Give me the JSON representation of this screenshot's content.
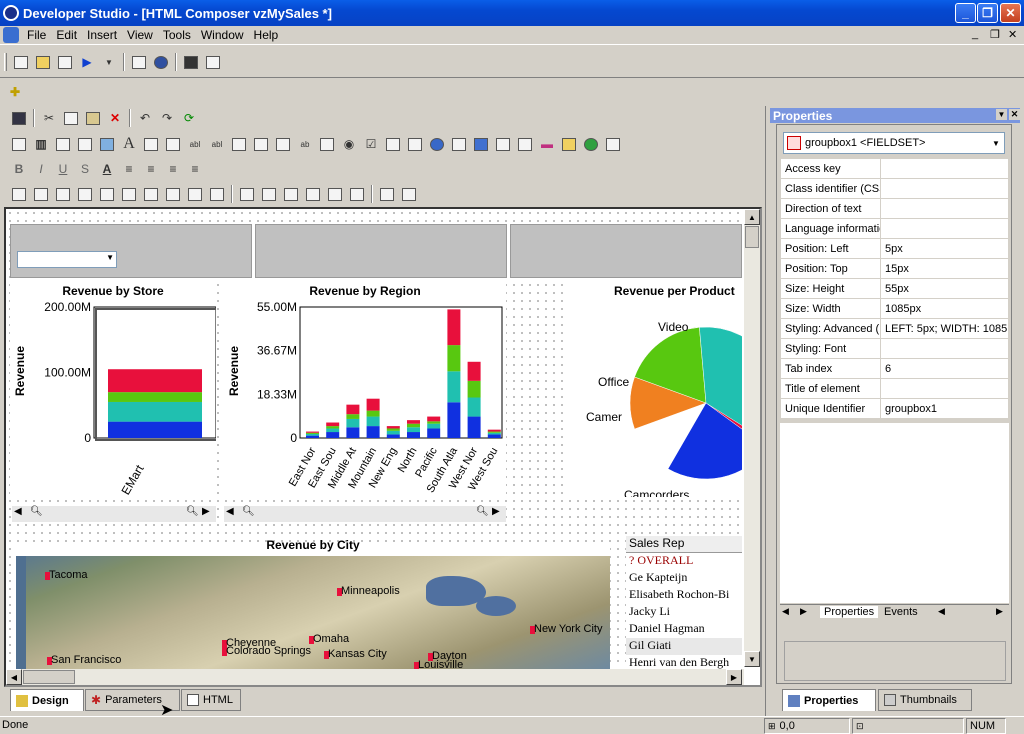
{
  "window": {
    "title": "Developer Studio - [HTML Composer vzMySales *]"
  },
  "menu": [
    "File",
    "Edit",
    "Insert",
    "View",
    "Tools",
    "Window",
    "Help"
  ],
  "charts": {
    "store": {
      "title": "Revenue by Store",
      "ylabel": "Revenue",
      "yticks": [
        "200.00M",
        "100.00M",
        "0"
      ],
      "category": "EMart"
    },
    "region": {
      "title": "Revenue by Region",
      "ylabel": "Revenue",
      "yticks": [
        "55.00M",
        "36.67M",
        "18.33M",
        "0"
      ],
      "categories": [
        "East Nor",
        "East Sou",
        "Middle At",
        "Mountain",
        "New Eng",
        "North",
        "Pacific",
        "South Atla",
        "West Nor",
        "West Sou"
      ]
    },
    "product": {
      "title": "Revenue per Product",
      "labels": [
        "Video",
        "Office",
        "Camer",
        "Camcorders"
      ]
    },
    "city": {
      "title": "Revenue by City",
      "cities": [
        "Tacoma",
        "Minneapolis",
        "New York City",
        "Cheyenne",
        "Omaha",
        "Colorado Springs",
        "San Francisco",
        "Kansas City",
        "Dayton",
        "Louisville"
      ]
    }
  },
  "chart_data": [
    {
      "type": "bar",
      "title": "Revenue by Store",
      "ylabel": "Revenue",
      "categories": [
        "EMart"
      ],
      "ylim": [
        0,
        200000000
      ],
      "series": [
        {
          "values": [
            25000000
          ],
          "color": "#1030e0"
        },
        {
          "values": [
            30000000
          ],
          "color": "#20c0b0"
        },
        {
          "values": [
            15000000
          ],
          "color": "#58c810"
        },
        {
          "values": [
            35000000
          ],
          "color": "#e8103c"
        }
      ]
    },
    {
      "type": "bar",
      "title": "Revenue by Region",
      "ylabel": "Revenue",
      "categories": [
        "East Nor",
        "East Sou",
        "Middle At",
        "Mountain",
        "New Eng",
        "North",
        "Pacific",
        "South Atla",
        "West Nor",
        "West Sou"
      ],
      "ylim": [
        0,
        55000000
      ],
      "series": [
        {
          "values": [
            1000000,
            2500000,
            4500000,
            5000000,
            1500000,
            2500000,
            4000000,
            15000000,
            9000000,
            1500000
          ],
          "color": "#1030e0"
        },
        {
          "values": [
            700000,
            1500000,
            3500000,
            4000000,
            1500000,
            2000000,
            2000000,
            13000000,
            8000000,
            700000
          ],
          "color": "#20c0b0"
        },
        {
          "values": [
            500000,
            1000000,
            2000000,
            2500000,
            1000000,
            1500000,
            1000000,
            11000000,
            7000000,
            500000
          ],
          "color": "#58c810"
        },
        {
          "values": [
            500000,
            1500000,
            4000000,
            5000000,
            1000000,
            1500000,
            2000000,
            15000000,
            8000000,
            800000
          ],
          "color": "#e8103c"
        }
      ]
    },
    {
      "type": "pie",
      "title": "Revenue per Product",
      "labels": [
        "Video",
        "Office",
        "Camer",
        "Camcorders"
      ],
      "values": [
        34,
        2,
        15,
        24
      ]
    }
  ],
  "salesrep": {
    "header": "Sales Rep",
    "items": [
      "?   OVERALL",
      "Ge Kapteijn",
      "Elisabeth Rochon-Bi",
      "Jacky Li",
      "Daniel Hagman",
      "Gil Giati",
      "Henri van den Bergh"
    ]
  },
  "bottomtabs": [
    "Design",
    "Parameters",
    "HTML"
  ],
  "properties": {
    "title": "Properties",
    "selector": "groupbox1 <FIELDSET>",
    "rows": [
      [
        "Access key",
        ""
      ],
      [
        "Class identifier (CSS",
        ""
      ],
      [
        "Direction of text",
        ""
      ],
      [
        "Language informatio",
        ""
      ],
      [
        "Position: Left",
        "5px"
      ],
      [
        "Position: Top",
        "15px"
      ],
      [
        "Size: Height",
        "55px"
      ],
      [
        "Size: Width",
        "1085px"
      ],
      [
        "Styling: Advanced (",
        "LEFT: 5px; WIDTH: 1085"
      ],
      [
        "Styling: Font",
        ""
      ],
      [
        "Tab index",
        "6"
      ],
      [
        "Title of element",
        ""
      ],
      [
        "Unique Identifier",
        "groupbox1"
      ]
    ],
    "tabs": [
      "Properties",
      "Events"
    ],
    "paneltabs": [
      "Properties",
      "Thumbnails"
    ]
  },
  "status": {
    "left": "Done",
    "coords": "0,0",
    "num": "NUM"
  }
}
